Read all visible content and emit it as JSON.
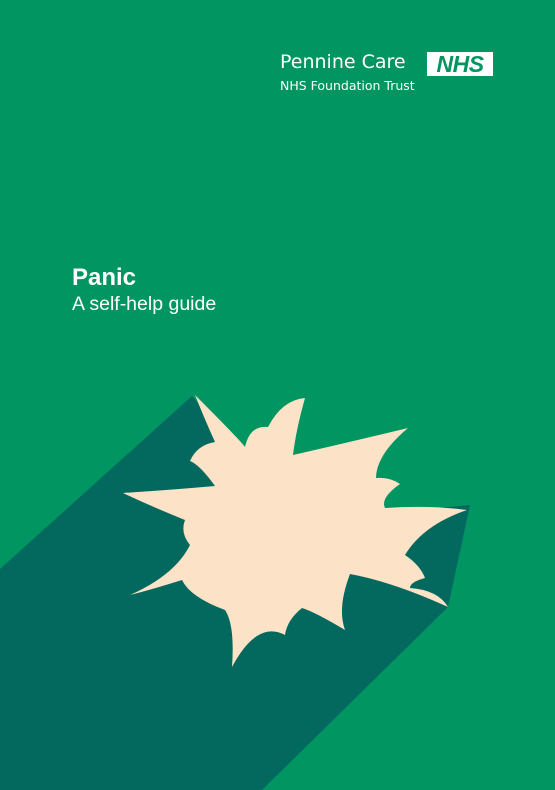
{
  "organization": {
    "name": "Pennine Care",
    "badge": "NHS",
    "subtitle": "NHS Foundation Trust"
  },
  "document": {
    "title": "Panic",
    "subtitle": "A self-help guide"
  },
  "colors": {
    "background": "#009561",
    "shadow": "#03695f",
    "burst": "#fce3c7",
    "text": "#ffffff"
  },
  "icons": {
    "illustration": "starburst-icon"
  }
}
